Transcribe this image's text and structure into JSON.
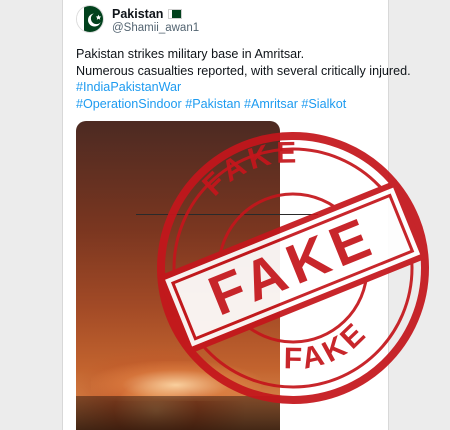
{
  "tweet": {
    "display_name": "Pakistan",
    "flag_icon": "pakistan-flag-icon",
    "handle": "@Shamii_awan1",
    "line1": "Pakistan strikes military base in Amritsar.",
    "line2": "Numerous casualties reported, with several critically injured.",
    "hashtag_line1": "#IndiaPakistanWar",
    "hashtag_line2": "#OperationSindoor #Pakistan #Amritsar #Sialkot"
  },
  "stamp": {
    "top_word": "FAKE",
    "middle_word": "FAKE",
    "bottom_word": "FAKE",
    "color": "#c4161c"
  },
  "colors": {
    "link": "#1d9bf0",
    "text": "#0f1419",
    "muted": "#536471",
    "flag_green": "#01411c"
  }
}
